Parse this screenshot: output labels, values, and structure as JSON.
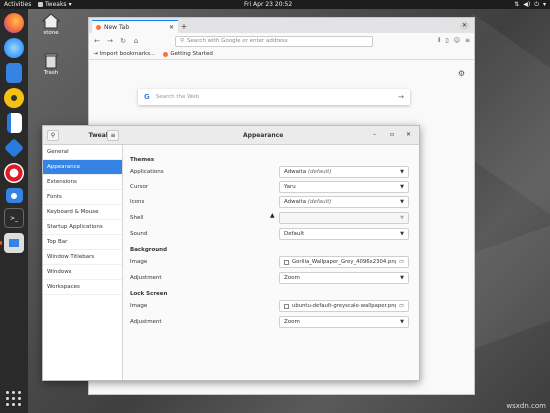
{
  "topbar": {
    "activities": "Activities",
    "app_name": "Tweaks",
    "clock": "Fri Apr 23  20:52",
    "sys_icons": [
      "network-icon",
      "volume-icon",
      "power-icon"
    ]
  },
  "dock": {
    "items": [
      "firefox",
      "thunderbird",
      "files",
      "rhythmbox",
      "writer",
      "software",
      "help",
      "screenshot",
      "terminal",
      "tweaks"
    ]
  },
  "desktop": {
    "home_label": "stone",
    "trash_label": "Trash"
  },
  "browser": {
    "tab_title": "New Tab",
    "url_placeholder": "Search with Google or enter address",
    "bookmarks": [
      "Import bookmarks...",
      "Getting Started"
    ],
    "search_placeholder": "Search the Web"
  },
  "tweaks": {
    "sidebar_title": "Tweaks",
    "panel_title": "Appearance",
    "sidebar_items": [
      "General",
      "Appearance",
      "Extensions",
      "Fonts",
      "Keyboard & Mouse",
      "Startup Applications",
      "Top Bar",
      "Window Titlebars",
      "Windows",
      "Workspaces"
    ],
    "themes": {
      "heading": "Themes",
      "applications_label": "Applications",
      "applications_value": "Adwaita",
      "applications_suffix": "(default)",
      "cursor_label": "Cursor",
      "cursor_value": "Yaru",
      "icons_label": "Icons",
      "icons_value": "Adwaita",
      "icons_suffix": "(default)",
      "shell_label": "Shell",
      "shell_value": "",
      "sound_label": "Sound",
      "sound_value": "Default"
    },
    "background": {
      "heading": "Background",
      "image_label": "Image",
      "image_value": "Gorilla_Wallpaper_Grey_4096x2304.png",
      "adjustment_label": "Adjustment",
      "adjustment_value": "Zoom"
    },
    "lockscreen": {
      "heading": "Lock Screen",
      "image_label": "Image",
      "image_value": "ubuntu-default-greyscale-wallpaper.png",
      "adjustment_label": "Adjustment",
      "adjustment_value": "Zoom"
    }
  },
  "watermark": "wsxdn.com"
}
